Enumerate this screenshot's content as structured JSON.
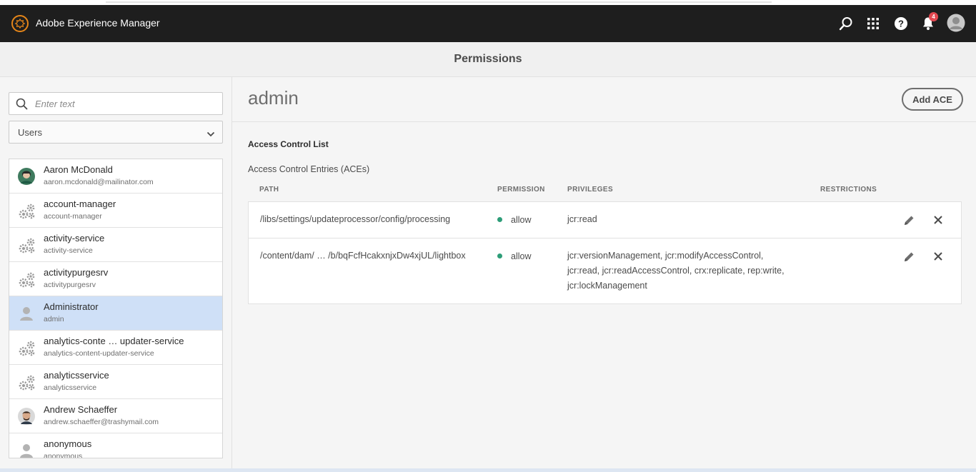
{
  "shell": {
    "app_title": "Adobe Experience Manager",
    "notification_count": "4",
    "icons": [
      "search-icon",
      "apps-grid-icon",
      "help-icon",
      "bell-icon",
      "user-avatar-icon"
    ]
  },
  "page": {
    "title": "Permissions"
  },
  "rail": {
    "search_placeholder": "Enter text",
    "filter_value": "Users",
    "items": [
      {
        "name": "Aaron McDonald",
        "sub": "aaron.mcdonald@mailinator.com",
        "avatar": "photo",
        "selected": false
      },
      {
        "name": "account-manager",
        "sub": "account-manager",
        "avatar": "gears",
        "selected": false
      },
      {
        "name": "activity-service",
        "sub": "activity-service",
        "avatar": "gears",
        "selected": false
      },
      {
        "name": "activitypurgesrv",
        "sub": "activitypurgesrv",
        "avatar": "gears",
        "selected": false
      },
      {
        "name": "Administrator",
        "sub": "admin",
        "avatar": "person",
        "selected": true
      },
      {
        "name": "analytics-conte … updater-service",
        "sub": "analytics-content-updater-service",
        "avatar": "gears",
        "selected": false
      },
      {
        "name": "analyticsservice",
        "sub": "analyticsservice",
        "avatar": "gears",
        "selected": false
      },
      {
        "name": "Andrew Schaeffer",
        "sub": "andrew.schaeffer@trashymail.com",
        "avatar": "photo2",
        "selected": false
      },
      {
        "name": "anonymous",
        "sub": "anonymous",
        "avatar": "person",
        "selected": false
      }
    ]
  },
  "content": {
    "title": "admin",
    "add_ace_label": "Add ACE",
    "acl_title": "Access Control List",
    "ace_title": "Access Control Entries (ACEs)",
    "columns": {
      "path": "PATH",
      "permission": "PERMISSION",
      "privileges": "PRIVILEGES",
      "restrictions": "RESTRICTIONS"
    },
    "entries": [
      {
        "path": "/libs/settings/updateprocessor/config/processing",
        "permission": "allow",
        "privileges": [
          "jcr:read"
        ],
        "restrictions": ""
      },
      {
        "path": "/content/dam/ … /b/bqFcfHcakxnjxDw4xjUL/lightbox",
        "permission": "allow",
        "privileges": [
          "jcr:versionManagement, jcr:modifyAccessControl,",
          "jcr:read, jcr:readAccessControl, crx:replicate, rep:write,",
          "jcr:lockManagement"
        ],
        "restrictions": ""
      }
    ],
    "row_actions": [
      "edit-icon",
      "close-icon"
    ]
  },
  "colors": {
    "shell_bg": "#1e1e1e",
    "selected_row": "#cfe0f7",
    "allow_dot": "#2d9d78",
    "badge": "#e34850",
    "brand_ring": "#e68619"
  }
}
